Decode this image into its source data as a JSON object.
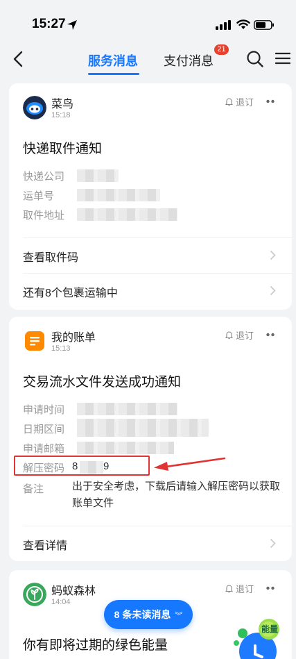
{
  "status_bar": {
    "time": "15:27"
  },
  "nav": {
    "tabs": [
      {
        "label": "服务消息",
        "active": true
      },
      {
        "label": "支付消息",
        "badge": "21"
      }
    ]
  },
  "cards": [
    {
      "app_name": "菜鸟",
      "time": "15:18",
      "unsubscribe_label": "退订",
      "title": "快递取件通知",
      "fields": [
        "快递公司",
        "运单号",
        "取件地址"
      ],
      "actions": [
        "查看取件码",
        "还有8个包裹运输中"
      ]
    },
    {
      "app_name": "我的账单",
      "time": "15:13",
      "unsubscribe_label": "退订",
      "title": "交易流水文件发送成功通知",
      "fields": [
        "申请时间",
        "日期区间",
        "申请邮箱"
      ],
      "password_label": "解压密码",
      "password_prefix": "8",
      "password_suffix": "9",
      "note_label": "备注",
      "note_text": "出于安全考虑，下载后请输入解压密码以获取账单文件",
      "actions": [
        "查看详情"
      ]
    },
    {
      "app_name": "蚂蚁森林",
      "time": "14:04",
      "unsubscribe_label": "退订",
      "title": "你有即将过期的绿色能量"
    }
  ],
  "unread": {
    "label": "8 条未读消息"
  },
  "energy_widget": {
    "label": "能量"
  },
  "colors": {
    "accent": "#1677ff",
    "badge": "#e8402c",
    "annotation": "#e03434",
    "bill_orange": "#ff8a00",
    "forest_green": "#3aa85c"
  }
}
